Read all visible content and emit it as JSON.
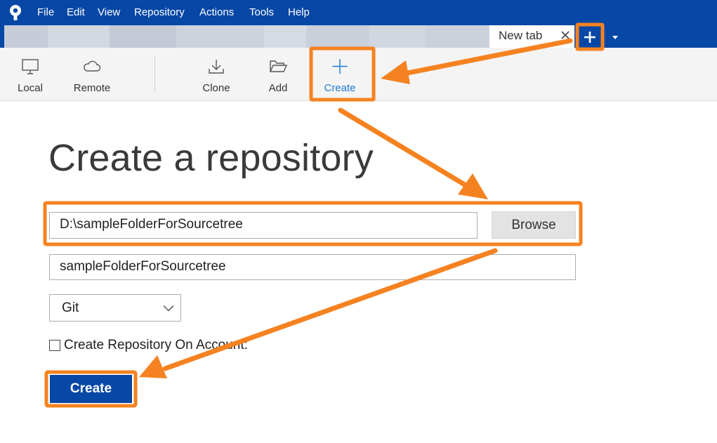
{
  "menubar": {
    "items": [
      "File",
      "Edit",
      "View",
      "Repository",
      "Actions",
      "Tools",
      "Help"
    ]
  },
  "tabs": {
    "active_label": "New tab",
    "blurred_tabs_note_colors": [
      "#c9d0db",
      "#bcc4d1",
      "#cdd3de"
    ]
  },
  "toolbar": {
    "items": [
      {
        "label": "Local",
        "icon": "monitor-icon"
      },
      {
        "label": "Remote",
        "icon": "cloud-icon"
      },
      {
        "label": "Clone",
        "icon": "download-icon"
      },
      {
        "label": "Add",
        "icon": "folder-open-icon"
      },
      {
        "label": "Create",
        "icon": "plus-icon",
        "active": true
      }
    ]
  },
  "main": {
    "title": "Create a repository",
    "path_value": "D:\\sampleFolderForSourcetree",
    "browse_label": "Browse",
    "name_value": "sampleFolderForSourcetree",
    "vcs_selected": "Git",
    "checkbox_label": "Create Repository On Account:",
    "checkbox_checked": false,
    "create_label": "Create"
  },
  "colors": {
    "brand": "#0747a6",
    "accent": "#1f78d1",
    "annotation": "#f58220"
  }
}
